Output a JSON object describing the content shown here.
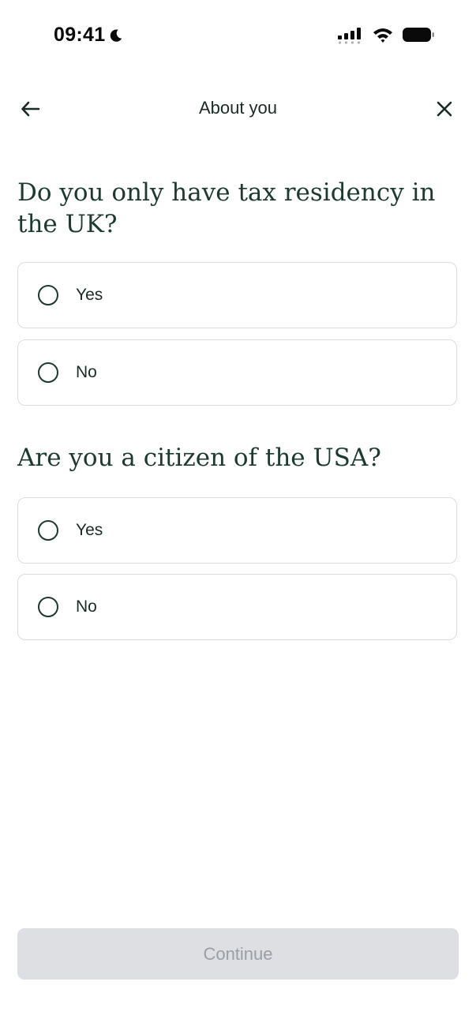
{
  "status_bar": {
    "time": "09:41",
    "icons": [
      "moon-icon",
      "cellular-signal-icon",
      "wifi-icon",
      "battery-icon"
    ]
  },
  "header": {
    "title": "About you",
    "back_icon": "back-arrow-icon",
    "close_icon": "close-icon"
  },
  "questions": [
    {
      "text": "Do you only have tax residency in the UK?",
      "options": [
        {
          "label": "Yes",
          "selected": false
        },
        {
          "label": "No",
          "selected": false
        }
      ]
    },
    {
      "text": "Are you a citizen of the USA?",
      "options": [
        {
          "label": "Yes",
          "selected": false
        },
        {
          "label": "No",
          "selected": false
        }
      ]
    }
  ],
  "continue_label": "Continue",
  "colors": {
    "primary_text": "#1c3a2e",
    "border": "#d9dcdf",
    "disabled_bg": "#dddfe3",
    "disabled_text": "#9a9ea5"
  }
}
